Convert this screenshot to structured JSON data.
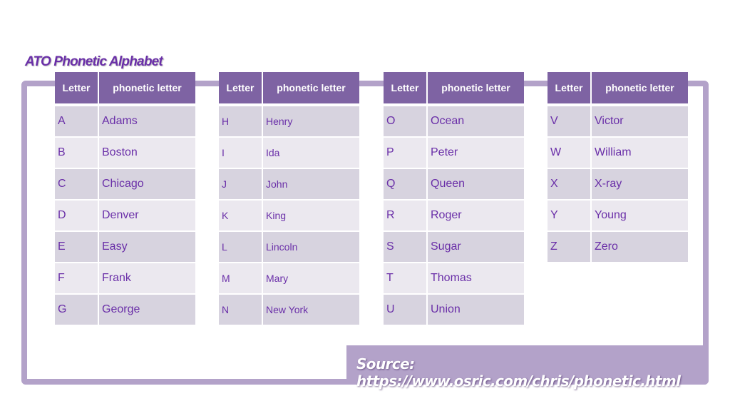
{
  "title": "ATO Phonetic Alphabet",
  "source": "Source: https://www.osric.com/chris/phonetic.html",
  "colors": {
    "header_bg": "#7e63a3",
    "frame": "#b3a2c9",
    "text": "#6a2fa8",
    "row_odd": "#d7d3df",
    "row_even": "#ebe8ef"
  },
  "tables": [
    {
      "headers": [
        "Letter",
        "phonetic letter"
      ],
      "rows": [
        [
          "A",
          "Adams"
        ],
        [
          "B",
          "Boston"
        ],
        [
          "C",
          "Chicago"
        ],
        [
          "D",
          "Denver"
        ],
        [
          "E",
          "Easy"
        ],
        [
          "F",
          "Frank"
        ],
        [
          "G",
          "George"
        ]
      ]
    },
    {
      "headers": [
        "Letter",
        "phonetic letter"
      ],
      "rows": [
        [
          "H",
          "Henry"
        ],
        [
          "I",
          "Ida"
        ],
        [
          "J",
          "John"
        ],
        [
          "K",
          "King"
        ],
        [
          "L",
          "Lincoln"
        ],
        [
          "M",
          "Mary"
        ],
        [
          "N",
          "New York"
        ]
      ]
    },
    {
      "headers": [
        "Letter",
        "phonetic letter"
      ],
      "rows": [
        [
          "O",
          "Ocean"
        ],
        [
          "P",
          "Peter"
        ],
        [
          "Q",
          "Queen"
        ],
        [
          "R",
          "Roger"
        ],
        [
          "S",
          "Sugar"
        ],
        [
          "T",
          "Thomas"
        ],
        [
          "U",
          "Union"
        ]
      ]
    },
    {
      "headers": [
        "Letter",
        "phonetic letter"
      ],
      "rows": [
        [
          "V",
          "Victor"
        ],
        [
          "W",
          "William"
        ],
        [
          "X",
          "X-ray"
        ],
        [
          "Y",
          "Young"
        ],
        [
          "Z",
          "Zero"
        ]
      ]
    }
  ]
}
